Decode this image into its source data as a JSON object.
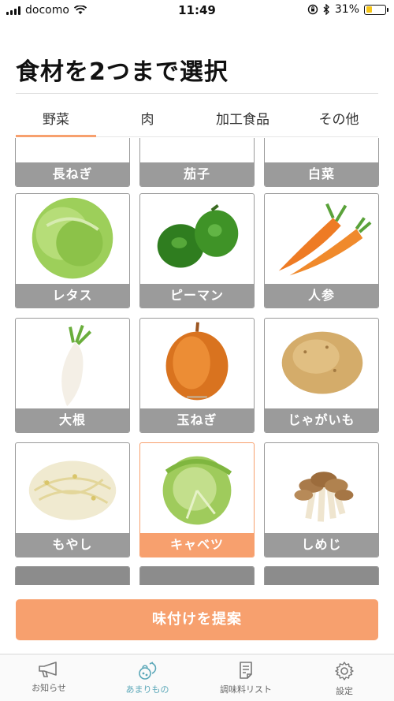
{
  "status_bar": {
    "carrier": "docomo",
    "time": "11:49",
    "battery_percent": "31%",
    "battery_level": 0.31,
    "icons": [
      "signal-icon",
      "wifi-icon",
      "orientation-lock-icon",
      "bluetooth-icon",
      "battery-icon"
    ]
  },
  "title": "食材を2つまで選択",
  "tabs": [
    {
      "label": "野菜",
      "active": true
    },
    {
      "label": "肉",
      "active": false
    },
    {
      "label": "加工食品",
      "active": false
    },
    {
      "label": "その他",
      "active": false
    }
  ],
  "ingredients": [
    {
      "label": "長ねぎ",
      "selected": false
    },
    {
      "label": "茄子",
      "selected": false
    },
    {
      "label": "白菜",
      "selected": false
    },
    {
      "label": "レタス",
      "selected": false
    },
    {
      "label": "ピーマン",
      "selected": false
    },
    {
      "label": "人参",
      "selected": false
    },
    {
      "label": "大根",
      "selected": false
    },
    {
      "label": "玉ねぎ",
      "selected": false
    },
    {
      "label": "じゃがいも",
      "selected": false
    },
    {
      "label": "もやし",
      "selected": false
    },
    {
      "label": "キャベツ",
      "selected": true
    },
    {
      "label": "しめじ",
      "selected": false
    }
  ],
  "suggest_button": "味付けを提案",
  "nav": [
    {
      "label": "お知らせ",
      "icon": "megaphone-icon",
      "active": false
    },
    {
      "label": "あまりもの",
      "icon": "leftover-food-icon",
      "active": true
    },
    {
      "label": "調味料リスト",
      "icon": "list-icon",
      "active": false
    },
    {
      "label": "設定",
      "icon": "gear-icon",
      "active": false
    }
  ],
  "colors": {
    "accent": "#f7a06e",
    "label_gray": "#9b9b9b",
    "active_nav": "#5aa7b8",
    "battery_fill": "#f5c518"
  }
}
